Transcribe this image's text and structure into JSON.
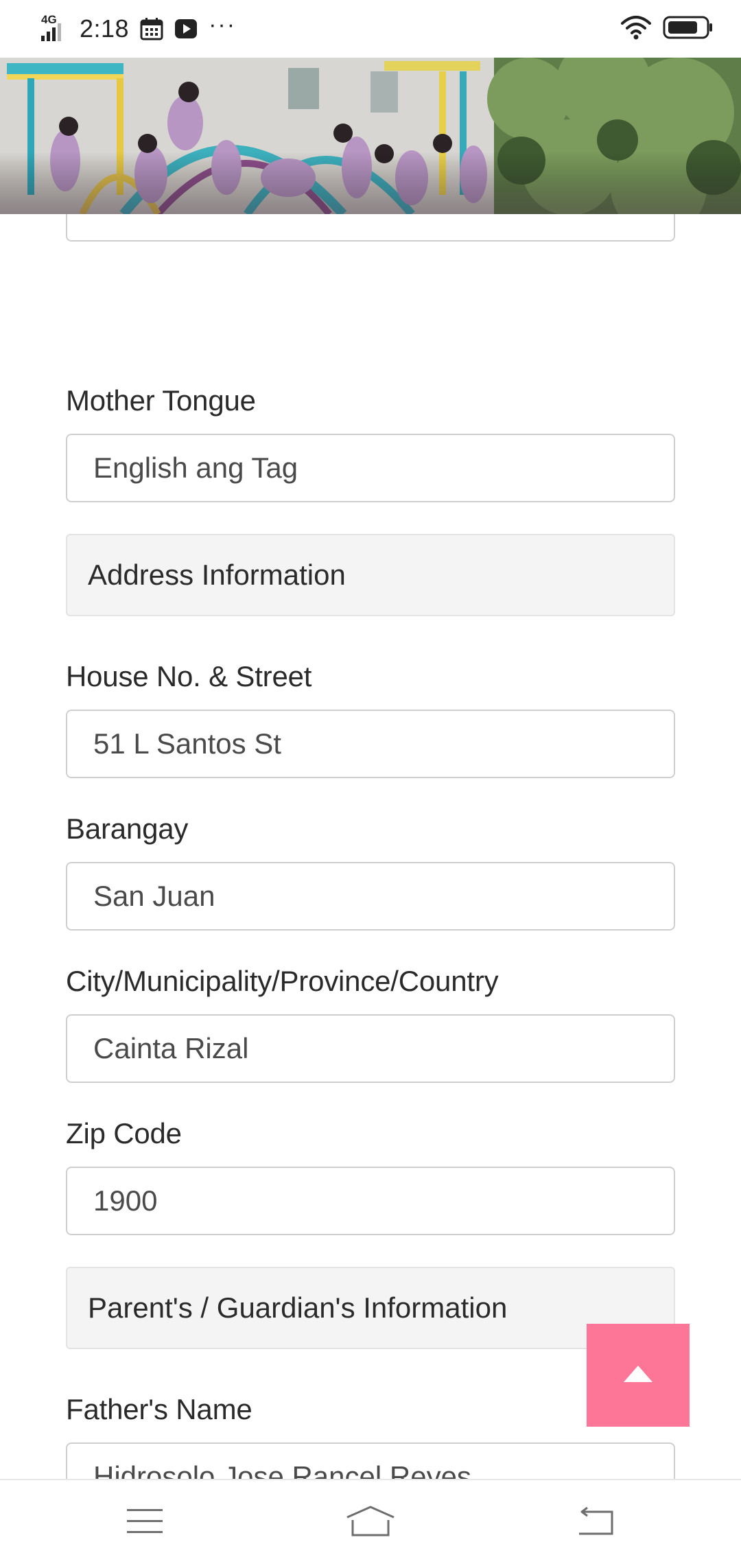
{
  "status_bar": {
    "network": "4G",
    "time": "2:18",
    "more": "···",
    "icons": [
      "signal-icon",
      "calendar-icon",
      "play-icon",
      "wifi-icon",
      "battery-icon"
    ]
  },
  "hero": {
    "image": "children-playground-photo"
  },
  "form": {
    "mother_tongue": {
      "label": "Mother Tongue",
      "value": "English ang Tag"
    },
    "address_section": {
      "title": "Address Information"
    },
    "house_street": {
      "label": "House No. & Street",
      "value": "51 L Santos St"
    },
    "barangay": {
      "label": "Barangay",
      "value": "San Juan"
    },
    "city": {
      "label": "City/Municipality/Province/Country",
      "value": "Cainta Rizal"
    },
    "zip": {
      "label": "Zip Code",
      "value": "1900"
    },
    "parent_section": {
      "title": "Parent's / Guardian's Information"
    },
    "father_name": {
      "label": "Father's Name",
      "value": "Hidrosolo Jose Rancel Reyes"
    }
  },
  "scroll_top": {
    "icon": "arrow-up-icon",
    "color": "#fd7597"
  },
  "nav_bar": {
    "items": [
      "menu-icon",
      "home-icon",
      "back-icon"
    ]
  }
}
